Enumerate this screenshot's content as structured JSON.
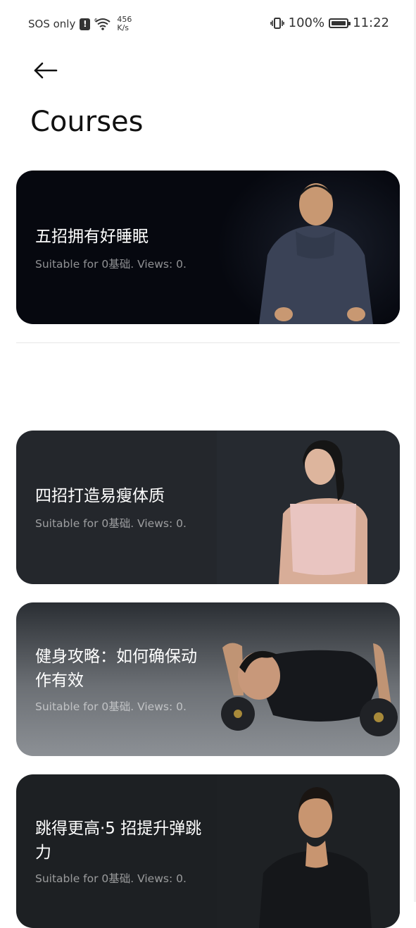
{
  "status_bar": {
    "carrier": "SOS only",
    "alert_glyph": "!",
    "net_speed_value": "456",
    "net_speed_unit": "K/s",
    "battery": "100%",
    "battery_level": 1.0,
    "time": "11:22"
  },
  "header": {
    "title": "Courses"
  },
  "courses": [
    {
      "title": "五招拥有好睡眠",
      "meta": "Suitable for 0基础. Views: 0."
    },
    {
      "title": "四招打造易瘦体质",
      "meta": "Suitable for 0基础. Views: 0."
    },
    {
      "title": "健身攻略：如何确保动作有效",
      "meta": "Suitable for 0基础. Views: 0."
    },
    {
      "title": "跳得更高·5 招提升弹跳力",
      "meta": "Suitable for 0基础. Views: 0."
    }
  ],
  "icons": {
    "back": "arrow-left-icon",
    "vibrate": "vibrate-icon",
    "wifi": "wifi-icon",
    "battery": "battery-icon"
  },
  "colors": {
    "card1_bg": "#06080f",
    "card2_bg": "#24272c",
    "card3_bg": "#5a5e63",
    "card4_bg": "#1d2023"
  }
}
